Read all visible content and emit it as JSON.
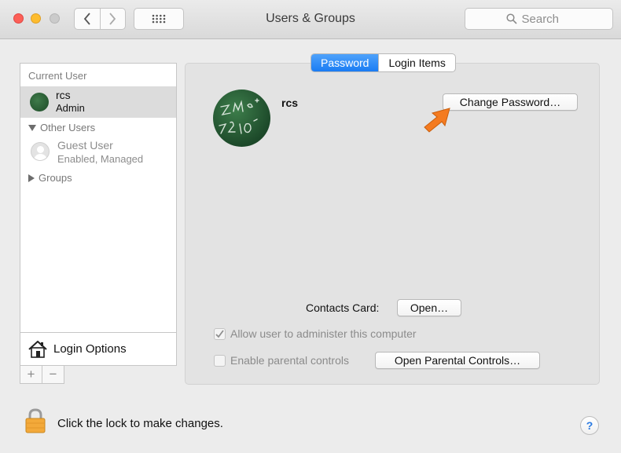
{
  "window": {
    "title": "Users & Groups"
  },
  "toolbar": {
    "search_placeholder": "Search"
  },
  "sidebar": {
    "current_user_header": "Current User",
    "current_user": {
      "name": "rcs",
      "role": "Admin"
    },
    "other_users_header": "Other Users",
    "guest_user": {
      "name": "Guest User",
      "status": "Enabled, Managed"
    },
    "groups_label": "Groups",
    "login_options_label": "Login Options",
    "add_label": "+",
    "remove_label": "−"
  },
  "tabs": [
    {
      "label": "Password",
      "active": true
    },
    {
      "label": "Login Items",
      "active": false
    }
  ],
  "user_panel": {
    "username": "rcs",
    "change_password_label": "Change Password…",
    "contacts_card_label": "Contacts Card:",
    "open_label": "Open…",
    "allow_admin_label": "Allow user to administer this computer",
    "allow_admin_checked": true,
    "parental_controls_label": "Enable parental controls",
    "parental_controls_checked": false,
    "open_parental_controls_label": "Open Parental Controls…"
  },
  "footer": {
    "lock_label": "Click the lock to make changes.",
    "help_label": "?"
  },
  "colors": {
    "accent": "#1a7cf3",
    "arrow": "#f47b20",
    "close": "#fc5f57",
    "minimize": "#fdbc2e"
  },
  "icons": [
    "back-chevron-icon",
    "forward-chevron-icon",
    "grid-icon",
    "search-icon",
    "house-icon",
    "checkmark-icon",
    "lock-icon",
    "disclosure-triangle-icon",
    "arrow-pointer-icon"
  ]
}
